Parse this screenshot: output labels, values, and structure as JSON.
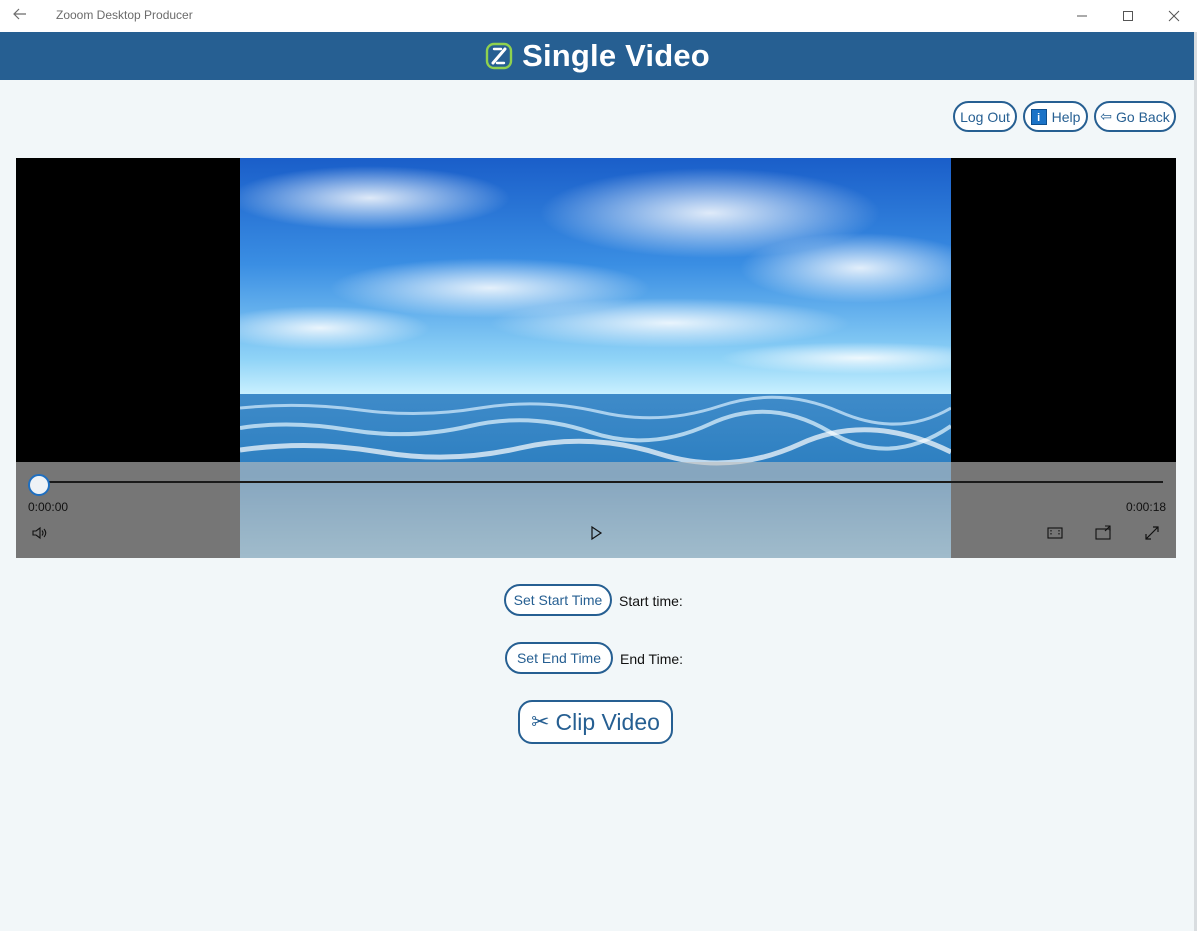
{
  "window": {
    "title": "Zooom Desktop Producer",
    "back_icon": "arrow-left-icon",
    "minimize_icon": "minimize-icon",
    "maximize_icon": "maximize-icon",
    "close_icon": "close-icon"
  },
  "header": {
    "title": "Single Video",
    "logo_icon": "zooom-logo-icon",
    "background": "#265f92"
  },
  "toolbar": {
    "logout_label": "Log Out",
    "help_label": "Help",
    "help_icon": "info-icon",
    "goback_label": "Go Back",
    "goback_arrow": "⇦"
  },
  "player": {
    "current_time": "0:00:00",
    "total_time": "0:00:18",
    "progress": 0,
    "volume_icon": "volume-icon",
    "play_icon": "play-icon",
    "aspect_icon": "aspect-ratio-icon",
    "cast_icon": "cast-icon",
    "fullscreen_icon": "fullscreen-icon"
  },
  "clip": {
    "set_start_label": "Set Start Time",
    "start_time_label": "Start time:",
    "start_time_value": "",
    "set_end_label": "Set End Time",
    "end_time_label": "End Time:",
    "end_time_value": "",
    "clip_label": "Clip Video",
    "clip_icon": "scissors-icon"
  },
  "colors": {
    "accent": "#265f92",
    "background": "#f2f7f9"
  }
}
